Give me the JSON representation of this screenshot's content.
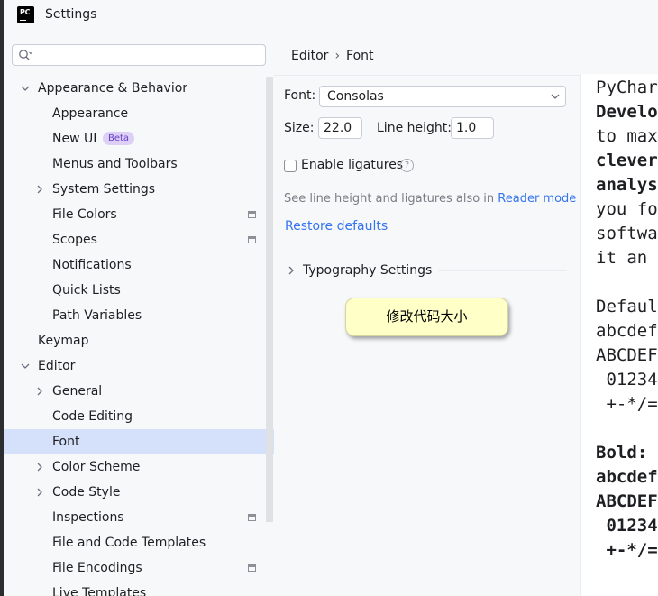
{
  "window": {
    "title": "Settings",
    "logo_text": "PC"
  },
  "search": {
    "placeholder": ""
  },
  "tree": [
    {
      "label": "Appearance & Behavior",
      "level": 0,
      "expanded": true,
      "bold": true
    },
    {
      "label": "Appearance",
      "level": 1
    },
    {
      "label": "New UI",
      "level": 1,
      "badge": "Beta"
    },
    {
      "label": "Menus and Toolbars",
      "level": 1
    },
    {
      "label": "System Settings",
      "level": 1,
      "collapsed": true
    },
    {
      "label": "File Colors",
      "level": 1,
      "project_icon": true
    },
    {
      "label": "Scopes",
      "level": 1,
      "project_icon": true
    },
    {
      "label": "Notifications",
      "level": 1
    },
    {
      "label": "Quick Lists",
      "level": 1
    },
    {
      "label": "Path Variables",
      "level": 1
    },
    {
      "label": "Keymap",
      "level": 0,
      "bold": true
    },
    {
      "label": "Editor",
      "level": 0,
      "expanded": true,
      "bold": true
    },
    {
      "label": "General",
      "level": 1,
      "collapsed": true
    },
    {
      "label": "Code Editing",
      "level": 1
    },
    {
      "label": "Font",
      "level": 1,
      "selected": true
    },
    {
      "label": "Color Scheme",
      "level": 1,
      "collapsed": true
    },
    {
      "label": "Code Style",
      "level": 1,
      "collapsed": true
    },
    {
      "label": "Inspections",
      "level": 1,
      "project_icon": true
    },
    {
      "label": "File and Code Templates",
      "level": 1
    },
    {
      "label": "File Encodings",
      "level": 1,
      "project_icon": true
    },
    {
      "label": "Live Templates",
      "level": 1
    }
  ],
  "breadcrumb": {
    "parent": "Editor",
    "separator": "›",
    "current": "Font"
  },
  "font": {
    "font_label": "Font:",
    "font_value": "Consolas",
    "size_label": "Size:",
    "size_value": "22.0",
    "line_height_label": "Line height:",
    "line_height_value": "1.0",
    "ligatures_label": "Enable ligatures",
    "ligatures_checked": false,
    "help_glyph": "?",
    "hint_text": "See line height and ligatures also in ",
    "hint_link": "Reader mode",
    "restore_label": "Restore defaults",
    "typography_label": "Typography Settings"
  },
  "tooltip": {
    "text": "修改代码大小"
  },
  "preview_lines": [
    {
      "text": "PyCharm",
      "bold": false
    },
    {
      "text": "Developer",
      "bold": true
    },
    {
      "text": "to max",
      "bold": false
    },
    {
      "text": "clever",
      "bold": true
    },
    {
      "text": "analys",
      "bold": true
    },
    {
      "text": "you fo",
      "bold": false
    },
    {
      "text": "softwa",
      "bold": false
    },
    {
      "text": "it an",
      "bold": false
    },
    {
      "text": "",
      "bold": false
    },
    {
      "text": "Default",
      "bold": false
    },
    {
      "text": "abcdef",
      "bold": false
    },
    {
      "text": "ABCDEFG",
      "bold": false
    },
    {
      "text": " 01234",
      "bold": false
    },
    {
      "text": " +-*/=",
      "bold": false
    },
    {
      "text": "",
      "bold": false
    },
    {
      "text": "Bold:",
      "bold": true
    },
    {
      "text": "abcdef",
      "bold": true
    },
    {
      "text": "ABCDEFG",
      "bold": true
    },
    {
      "text": " 01234",
      "bold": true
    },
    {
      "text": " +-*/=",
      "bold": true
    }
  ]
}
